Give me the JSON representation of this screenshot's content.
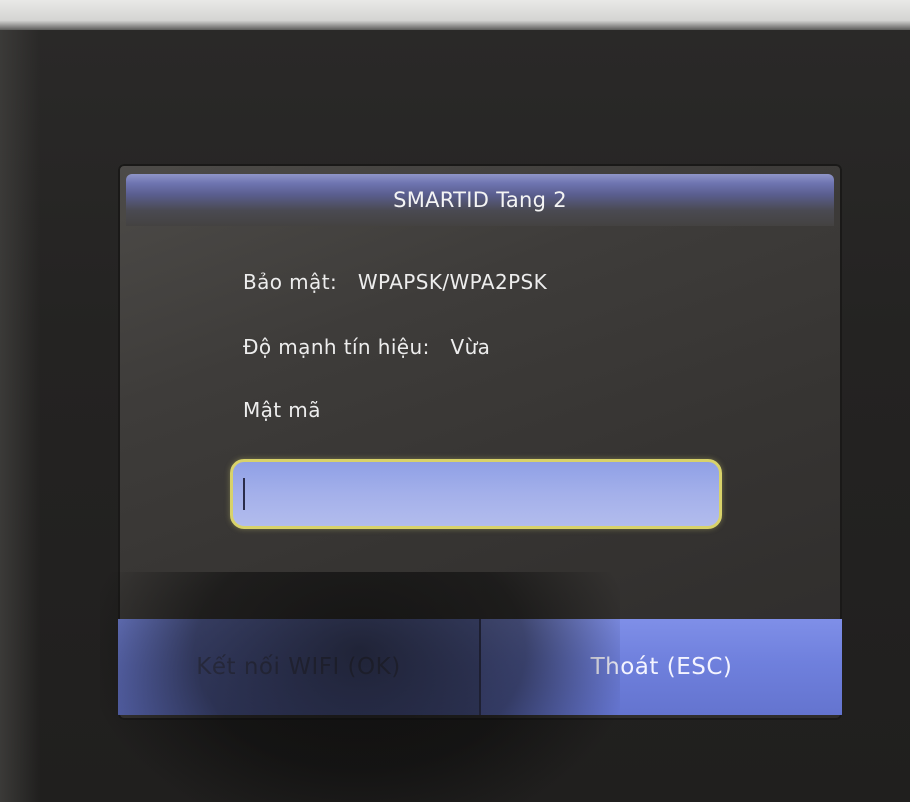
{
  "dialog": {
    "title": "SMARTID Tang 2",
    "security": {
      "label": "Bảo mật:",
      "value": "WPAPSK/WPA2PSK"
    },
    "signal": {
      "label": "Độ mạnh tín hiệu:",
      "value": "Vừa"
    },
    "password": {
      "label": "Mật mã",
      "value": ""
    },
    "buttons": {
      "connect_label": "Kết nối WIFI (OK)",
      "exit_label": "Thoát (ESC)"
    }
  },
  "colors": {
    "title_bar": "#6e74b0",
    "button_fill": "#7080dd",
    "field_border": "#d8d26a",
    "field_fill": "#a4b0ea"
  }
}
